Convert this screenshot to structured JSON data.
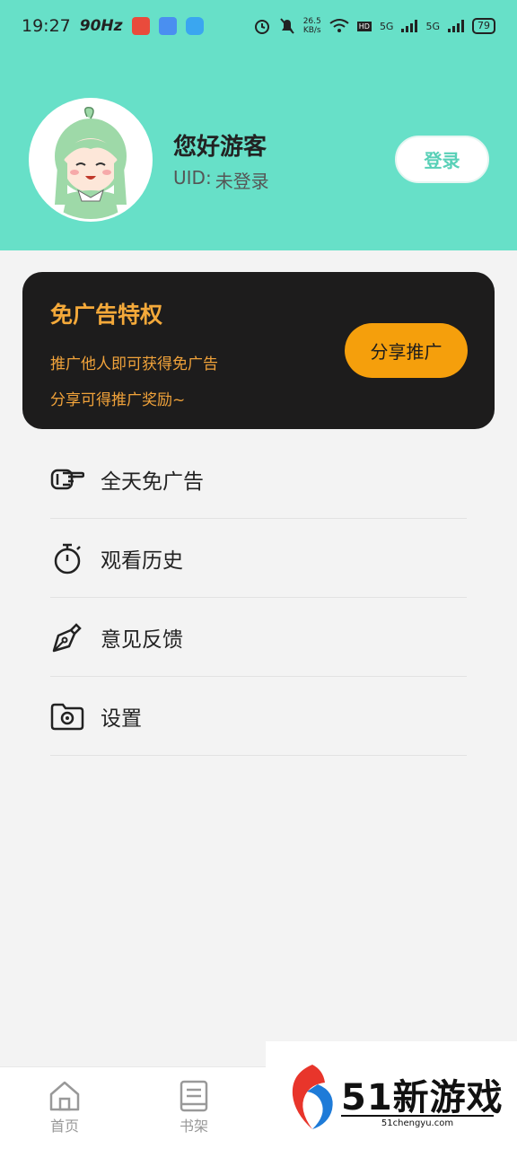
{
  "status_bar": {
    "time": "19:27",
    "refresh_rate": "90Hz",
    "speed_value": "26.5",
    "speed_unit": "KB/s",
    "signal_1": "5G",
    "signal_2": "5G",
    "battery": "79"
  },
  "profile": {
    "greeting": "您好游客",
    "uid_label": "UID:",
    "uid_value": "未登录",
    "login_label": "登录"
  },
  "promo": {
    "title": "免广告特权",
    "line1": "推广他人即可获得免广告",
    "line2": "分享可得推广奖励~",
    "share_label": "分享推广",
    "title_color": "#f4a93a",
    "button_color": "#f59f0c"
  },
  "menu": {
    "items": [
      {
        "label": "全天免广告",
        "icon": "pointing-hand-icon"
      },
      {
        "label": "观看历史",
        "icon": "stopwatch-icon"
      },
      {
        "label": "意见反馈",
        "icon": "pen-nib-icon"
      },
      {
        "label": "设置",
        "icon": "folder-gear-icon"
      }
    ]
  },
  "bottom_nav": {
    "tabs": [
      {
        "label": "首页",
        "icon": "home-icon"
      },
      {
        "label": "书架",
        "icon": "bookshelf-icon"
      }
    ]
  },
  "watermark": {
    "brand": "51新游戏",
    "site": "51chengyu.com"
  },
  "colors": {
    "header_bg": "#67e0c8",
    "accent": "#58d0b7",
    "card_bg": "#1d1c1c",
    "page_bg": "#f3f3f3"
  }
}
